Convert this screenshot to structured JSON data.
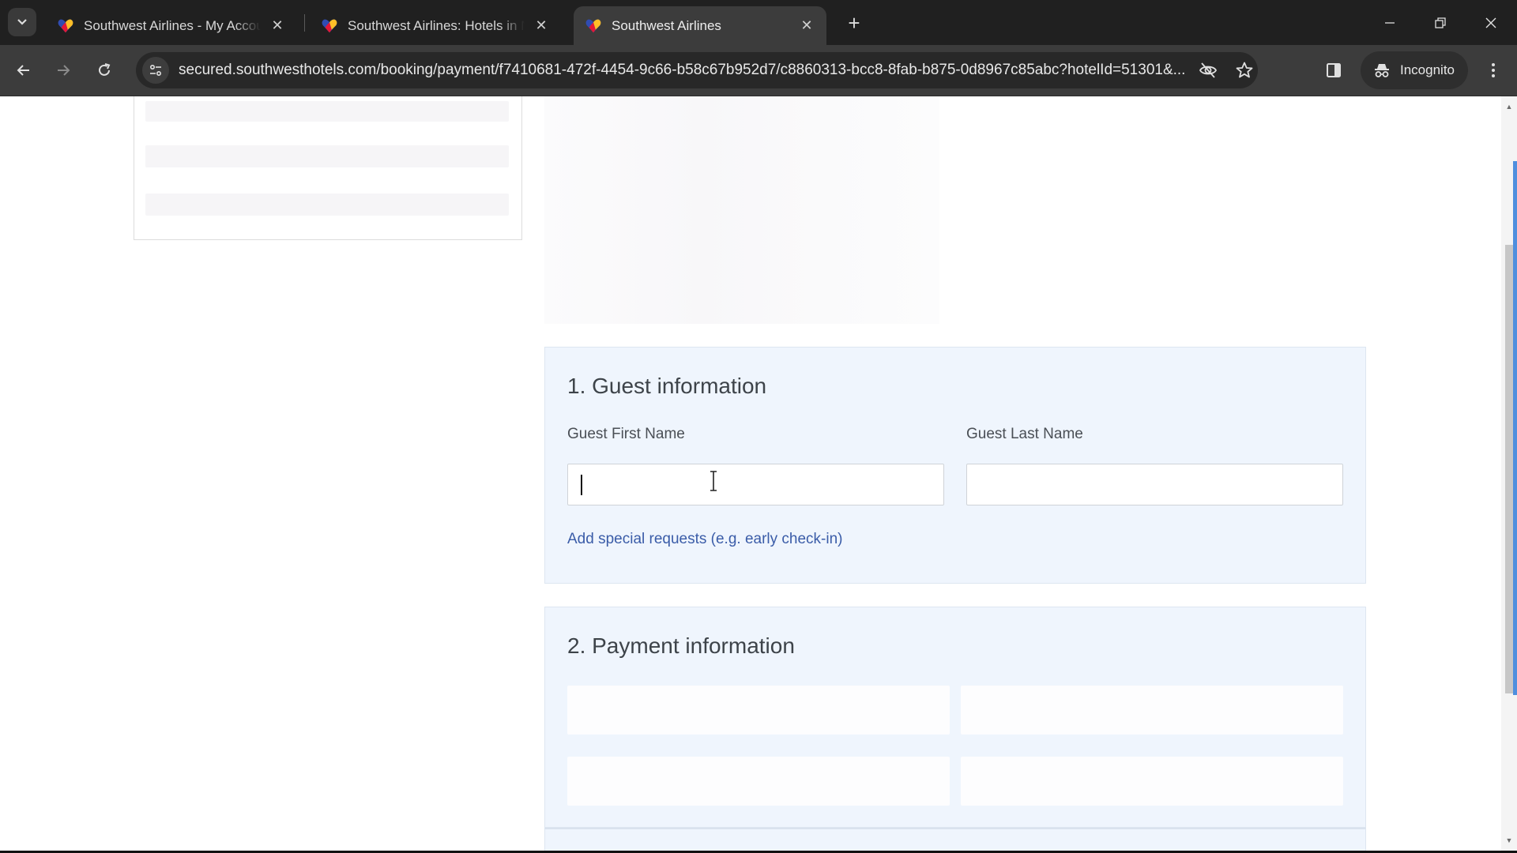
{
  "browser": {
    "tabs": [
      {
        "title": "Southwest Airlines - My Account",
        "active": false
      },
      {
        "title": "Southwest Airlines: Hotels in New York",
        "active": false
      },
      {
        "title": "Southwest Airlines",
        "active": true
      }
    ],
    "new_tab_label": "+",
    "url": "secured.southwesthotels.com/booking/payment/f7410681-472f-4454-9c66-b58c67b952d7/c8860313-bcc8-8fab-b875-0d8967c85abc?hotelId=51301&...",
    "profile_label": "Incognito",
    "icons": {
      "tab_search": "chevron-down-icon",
      "back": "arrow-left-icon",
      "forward": "arrow-right-icon",
      "reload": "reload-icon",
      "site_info": "tune-icon",
      "tracking": "eye-off-icon",
      "bookmark": "star-icon",
      "side_panel": "side-panel-icon",
      "incognito": "incognito-icon",
      "menu": "kebab-menu-icon",
      "minimize": "minimize-icon",
      "restore": "restore-icon",
      "close": "close-icon"
    },
    "colors": {
      "favicon_red": "#e31837",
      "favicon_yellow": "#ffbf27",
      "favicon_blue": "#304cb2"
    }
  },
  "guest_section": {
    "title": "1. Guest information",
    "first_name_label": "Guest First Name",
    "first_name_value": "",
    "last_name_label": "Guest Last Name",
    "last_name_value": "",
    "special_requests_link": "Add special requests (e.g. early check-in)"
  },
  "payment_section": {
    "title": "2. Payment information"
  },
  "colors": {
    "card_bg": "#eff5fd",
    "link": "#3a5ca8",
    "heading": "#3d4349",
    "scroll_accent": "#4f8fde"
  }
}
